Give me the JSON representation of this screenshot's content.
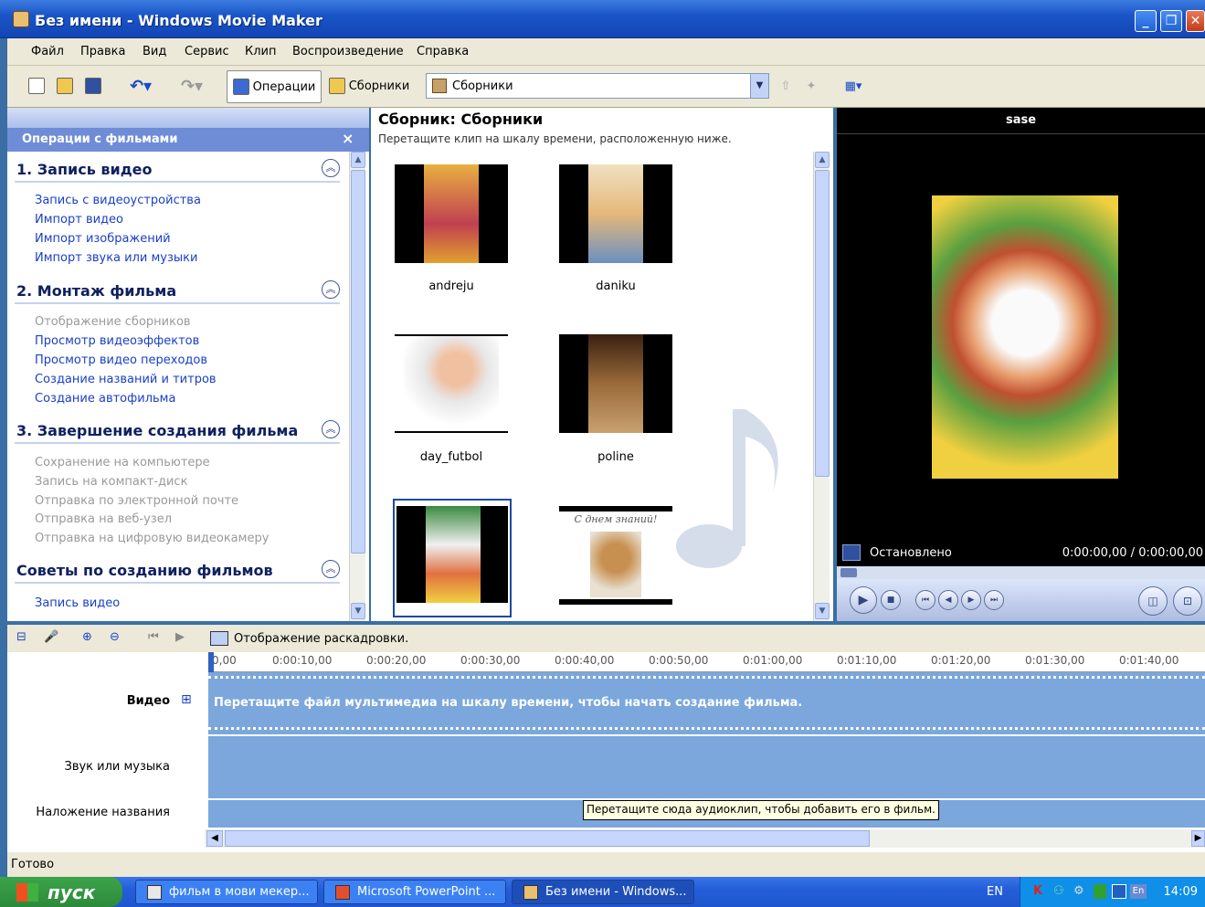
{
  "window": {
    "title": "Без имени - Windows Movie Maker",
    "min_label": "_",
    "max_label": "❐",
    "close_label": "✕"
  },
  "menu": [
    "Файл",
    "Правка",
    "Вид",
    "Сервис",
    "Клип",
    "Воспроизведение",
    "Справка"
  ],
  "toolbar": {
    "operations_label": "Операции",
    "collections_label": "Сборники",
    "combo_value": "Сборники"
  },
  "tasks": {
    "header": "Операции с фильмами",
    "close_label": "×",
    "sections": [
      {
        "title": "1. Запись видео",
        "links": [
          {
            "label": "Запись с видеоустройства",
            "enabled": true
          },
          {
            "label": "Импорт видео",
            "enabled": true
          },
          {
            "label": "Импорт изображений",
            "enabled": true
          },
          {
            "label": "Импорт звука или музыки",
            "enabled": true
          }
        ]
      },
      {
        "title": "2. Монтаж фильма",
        "links": [
          {
            "label": "Отображение сборников",
            "enabled": false
          },
          {
            "label": "Просмотр видеоэффектов",
            "enabled": true
          },
          {
            "label": "Просмотр видео переходов",
            "enabled": true
          },
          {
            "label": "Создание названий и титров",
            "enabled": true
          },
          {
            "label": "Создание автофильма",
            "enabled": true
          }
        ]
      },
      {
        "title": "3. Завершение создания фильма",
        "links": [
          {
            "label": "Сохранение на компьютере",
            "enabled": false
          },
          {
            "label": "Запись на компакт-диск",
            "enabled": false
          },
          {
            "label": "Отправка по электронной почте",
            "enabled": false
          },
          {
            "label": "Отправка на веб-узел",
            "enabled": false
          },
          {
            "label": "Отправка на цифровую видеокамеру",
            "enabled": false
          }
        ]
      },
      {
        "title": "Советы по созданию фильмов",
        "links": [
          {
            "label": "Запись видео",
            "enabled": true
          }
        ]
      }
    ]
  },
  "collection": {
    "title": "Сборник: Сборники",
    "subtitle": "Перетащите клип на шкалу времени, расположенную ниже.",
    "clips": [
      {
        "name": "andreju",
        "color": "#d8a040"
      },
      {
        "name": "daniku",
        "color": "#e6b87a"
      },
      {
        "name": "day_futbol",
        "color": "#e8d8c8"
      },
      {
        "name": "poline",
        "color": "#9a6a3a"
      },
      {
        "name": "",
        "color": "#d89058"
      },
      {
        "name": "",
        "color": "#e8e0d0",
        "caption_text": "С днем знаний!"
      }
    ]
  },
  "preview": {
    "title": "sase",
    "status": "Остановлено",
    "time": "0:00:00,00 / 0:00:00,00"
  },
  "timeline": {
    "storyboard_label": "Отображение раскадровки.",
    "ruler": [
      "0,00",
      "0:00:10,00",
      "0:00:20,00",
      "0:00:30,00",
      "0:00:40,00",
      "0:00:50,00",
      "0:01:00,00",
      "0:01:10,00",
      "0:01:20,00",
      "0:01:30,00",
      "0:01:40,00"
    ],
    "video_label": "Видео",
    "expand_label": "⊞",
    "video_hint": "Перетащите файл мультимедиа на шкалу времени, чтобы начать создание фильма.",
    "audio_label": "Звук или музыка",
    "title_label": "Наложение названия",
    "tooltip": "Перетащите сюда аудиоклип, чтобы добавить его в фильм."
  },
  "statusbar": "Готово",
  "taskbar": {
    "start": "пуск",
    "items": [
      "фильм в мови мекер...",
      "Microsoft PowerPoint ...",
      "Без имени - Windows..."
    ],
    "lang": "EN",
    "clock": "14:09"
  }
}
